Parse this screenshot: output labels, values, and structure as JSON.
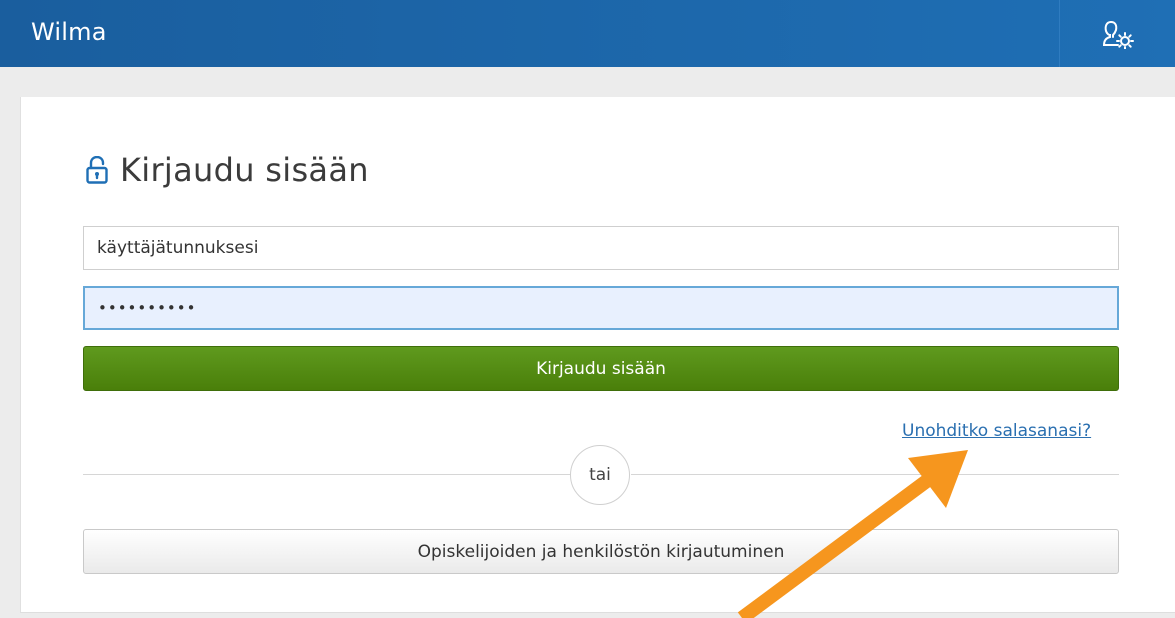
{
  "header": {
    "app_title": "Wilma",
    "user_settings_icon": "user-gear-icon",
    "background_color": "#1f6fb5"
  },
  "login": {
    "lock_icon": "unlock-icon",
    "heading": "Kirjaudu sisään",
    "username_value": "käyttäjätunnuksesi",
    "password_value": "••••••••••",
    "submit_label": "Kirjaudu sisään",
    "forgot_password_link": "Unohditko salasanasi?",
    "divider_text": "tai",
    "sso_button_label": "Opiskelijoiden ja henkilöstön kirjautuminen"
  },
  "annotation": {
    "arrow_color": "#f6961e",
    "arrow_icon": "pointer-arrow"
  },
  "colors": {
    "accent": "#1f6fb5",
    "submit_green": "#4e850d",
    "link_blue": "#2a6fb0"
  }
}
